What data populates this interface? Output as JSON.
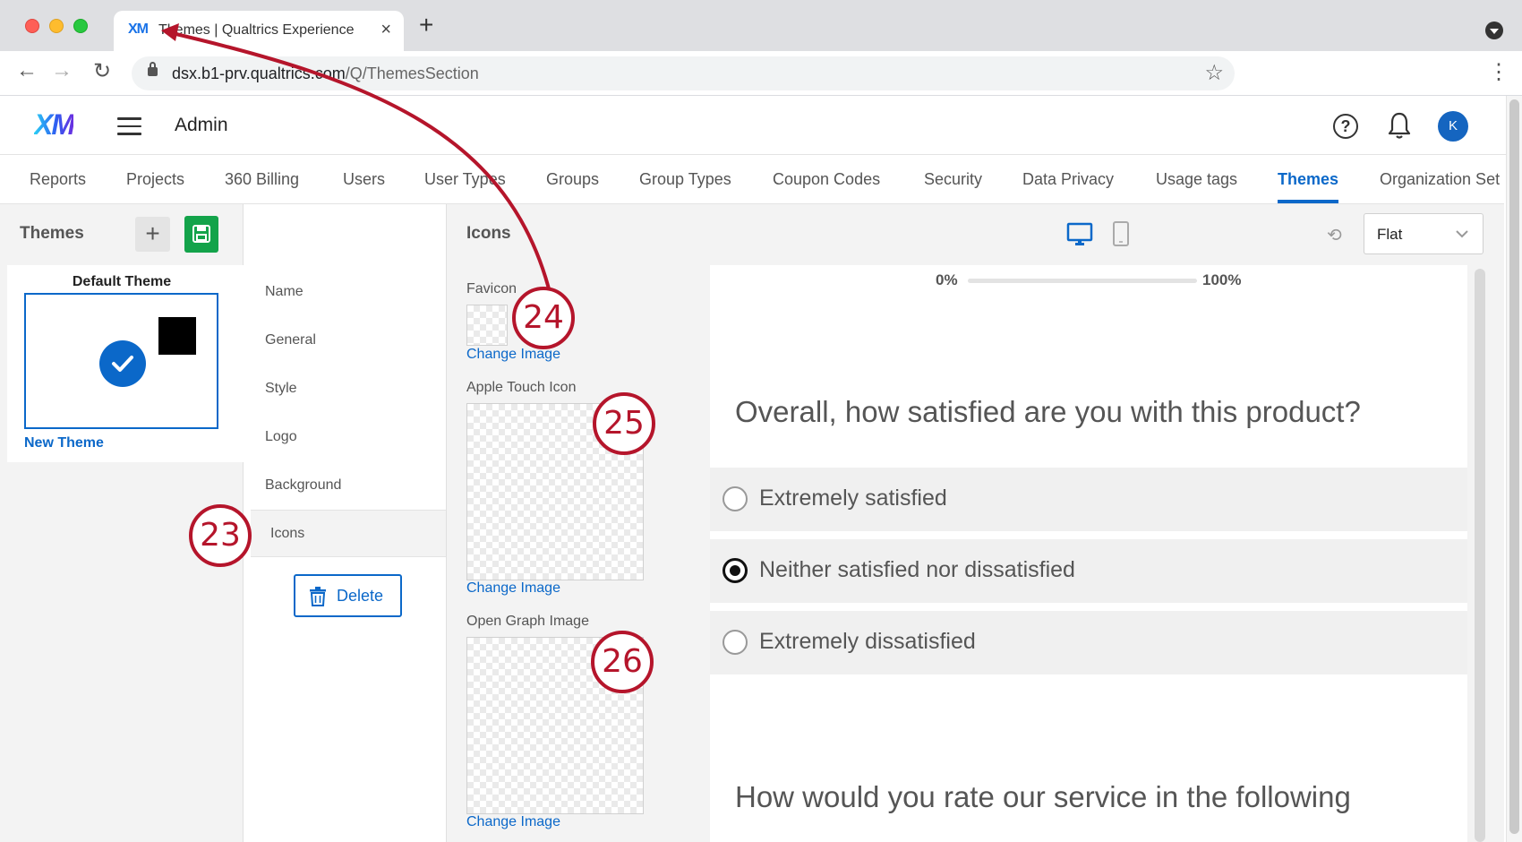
{
  "browser": {
    "tab_favicon": "XM",
    "tab_title": "Themes | Qualtrics Experience",
    "tab_close": "×",
    "new_tab": "+",
    "url_host": "dsx.b1-prv.qualtrics.com",
    "url_path": "/Q/ThemesSection",
    "back": "←",
    "forward": "→",
    "reload": "↻",
    "bookmark": "☆",
    "menu": "⋮"
  },
  "header": {
    "logo": "XM",
    "title": "Admin",
    "help": "?",
    "avatar_initial": "K"
  },
  "admin_tabs": [
    {
      "label": "Reports"
    },
    {
      "label": "Projects"
    },
    {
      "label": "360 Billing"
    },
    {
      "label": "Users"
    },
    {
      "label": "User Types"
    },
    {
      "label": "Groups"
    },
    {
      "label": "Group Types"
    },
    {
      "label": "Coupon Codes"
    },
    {
      "label": "Security"
    },
    {
      "label": "Data Privacy"
    },
    {
      "label": "Usage tags"
    },
    {
      "label": "Themes"
    },
    {
      "label": "Organization Set"
    }
  ],
  "active_tab": "Themes",
  "themes_panel": {
    "title": "Themes",
    "add_label": "+",
    "card_name": "Default Theme",
    "new_theme": "New Theme"
  },
  "settings": {
    "items": [
      {
        "label": "Name"
      },
      {
        "label": "General"
      },
      {
        "label": "Style"
      },
      {
        "label": "Logo"
      },
      {
        "label": "Background"
      },
      {
        "label": "Icons"
      }
    ],
    "active": "Icons",
    "delete_label": "Delete"
  },
  "icons_panel": {
    "title": "Icons",
    "favicon_label": "Favicon",
    "apple_label": "Apple Touch Icon",
    "og_label": "Open Graph Image",
    "change_image": "Change Image",
    "layout_value": "Flat",
    "refresh": "⟲"
  },
  "preview": {
    "progress_start": "0%",
    "progress_end": "100%",
    "progress_value": 0,
    "question1": "Overall, how satisfied are you with this product?",
    "choices": [
      {
        "label": "Extremely satisfied",
        "selected": false
      },
      {
        "label": "Neither satisfied nor dissatisfied",
        "selected": true
      },
      {
        "label": "Extremely dissatisfied",
        "selected": false
      }
    ],
    "question2": "How would you rate our service in the following"
  },
  "callouts": {
    "c23": "23",
    "c24": "24",
    "c25": "25",
    "c26": "26"
  },
  "colors": {
    "accent": "#0b68c9",
    "save_green": "#13a34a",
    "callout_red": "#b5152b"
  }
}
